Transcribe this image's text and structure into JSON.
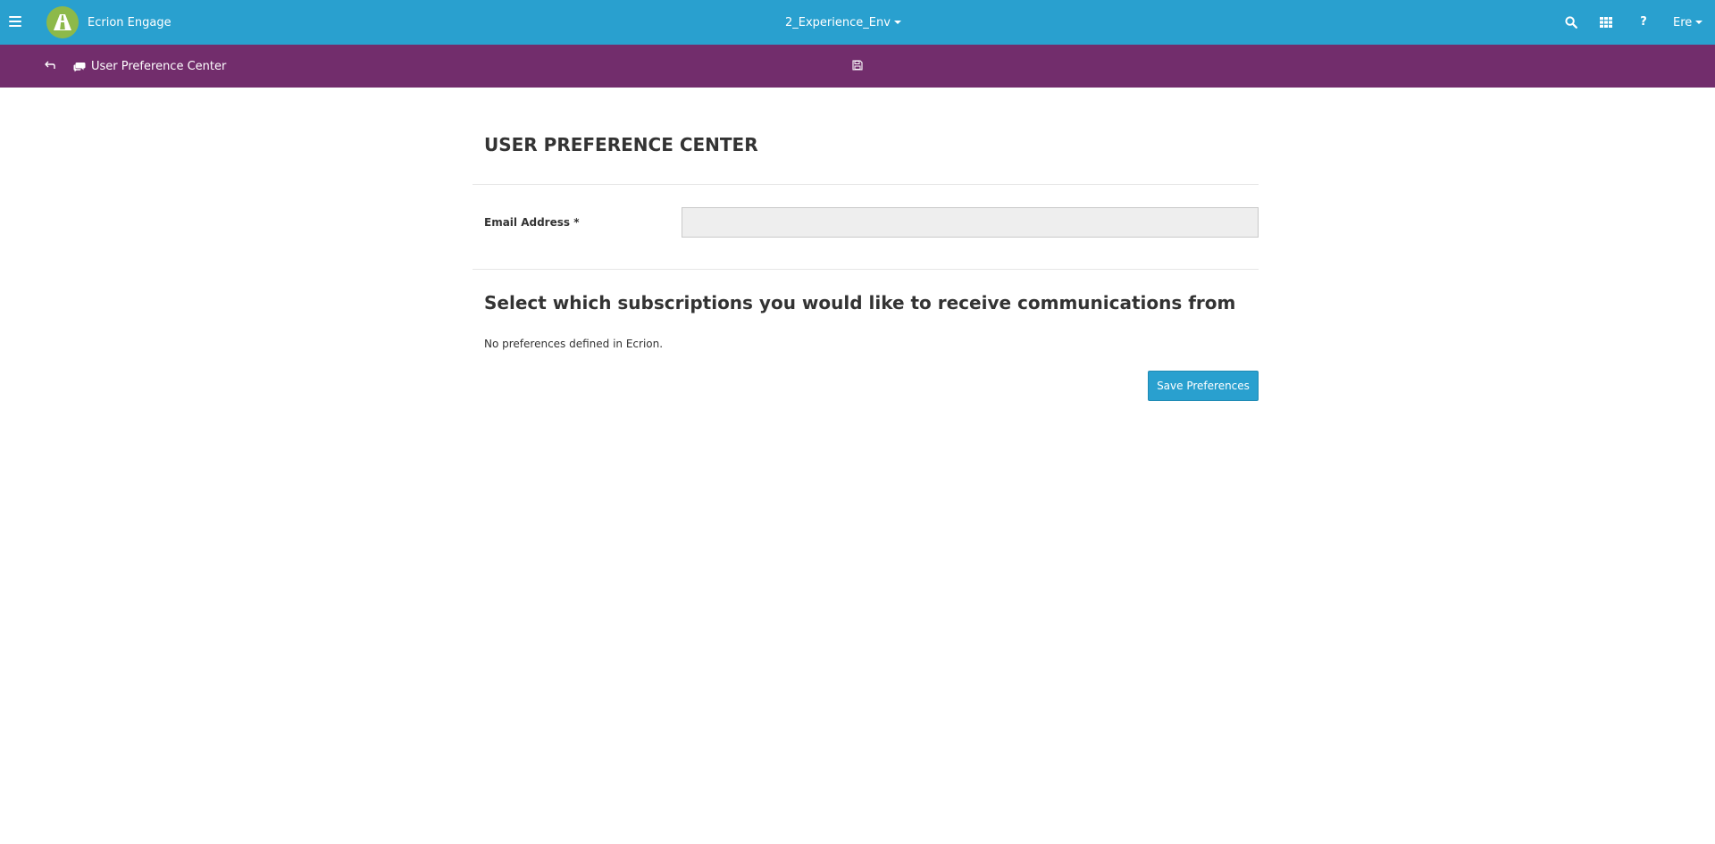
{
  "topbar": {
    "app_name": "Ecrion Engage",
    "environment": "2_Experience_Env",
    "help_label": "?",
    "user_label": "Ere",
    "icons": [
      "menu-icon",
      "logo-road-icon",
      "search-icon",
      "grid-icon",
      "help-icon",
      "caret-down-icon"
    ],
    "colors": {
      "background": "#29a0cf",
      "logo": "#8db94a"
    }
  },
  "toolbar": {
    "page_name": "User Preference Center",
    "icons": [
      "back-arrow-icon",
      "comments-icon",
      "save-icon"
    ],
    "colors": {
      "background": "#722d6c"
    }
  },
  "main": {
    "heading": "USER PREFERENCE CENTER",
    "email_label": "Email Address *",
    "email_value": "",
    "subscriptions_heading": "Select which subscriptions you would like to receive communications from",
    "empty_message": "No preferences defined in Ecrion.",
    "save_button_label": "Save Preferences",
    "colors": {
      "button": "#29a0cf",
      "input_background": "#eeeeee"
    }
  }
}
